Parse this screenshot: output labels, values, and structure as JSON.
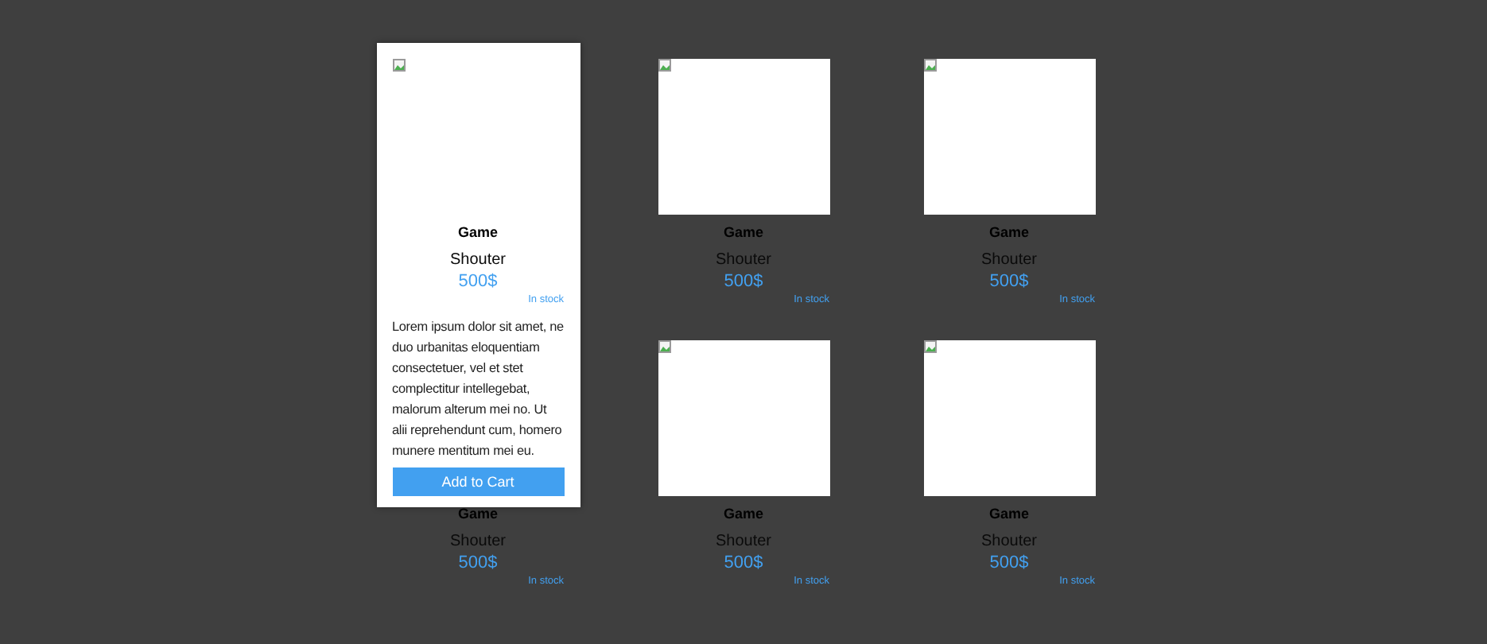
{
  "products": [
    {
      "title": "Game",
      "genre": "Shouter",
      "price": "500$",
      "stock": "In stock",
      "expanded": true,
      "description": "Lorem ipsum dolor sit amet, ne duo urbanitas eloquentiam consectetuer, vel et stet complectitur intellegebat, malorum alterum mei no. Ut alii reprehendunt cum, homero munere mentitum mei eu.",
      "button": "Add to Cart"
    },
    {
      "title": "Game",
      "genre": "Shouter",
      "price": "500$",
      "stock": "In stock",
      "expanded": false
    },
    {
      "title": "Game",
      "genre": "Shouter",
      "price": "500$",
      "stock": "In stock",
      "expanded": false
    },
    {
      "title": "Game",
      "genre": "Shouter",
      "price": "500$",
      "stock": "In stock",
      "expanded": false
    },
    {
      "title": "Game",
      "genre": "Shouter",
      "price": "500$",
      "stock": "In stock",
      "expanded": false
    },
    {
      "title": "Game",
      "genre": "Shouter",
      "price": "500$",
      "stock": "In stock",
      "expanded": false
    }
  ]
}
